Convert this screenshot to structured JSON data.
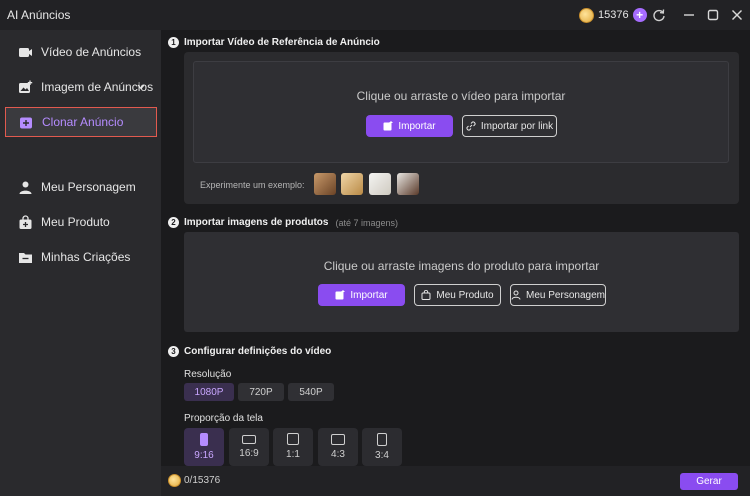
{
  "app": {
    "title": "AI Anúncios"
  },
  "header": {
    "credits": "15376",
    "plus": "+"
  },
  "sidebar": {
    "items": [
      {
        "label": "Vídeo de Anúncios"
      },
      {
        "label": "Imagem de Anúncios"
      },
      {
        "label": "Clonar Anúncio"
      },
      {
        "label": "Meu Personagem"
      },
      {
        "label": "Meu Produto"
      },
      {
        "label": "Minhas Criações"
      }
    ]
  },
  "section1": {
    "number": "1",
    "title": "Importar Vídeo de Referência de Anúncio",
    "drop_text": "Clique ou arraste o vídeo para importar",
    "import_label": "Importar",
    "link_label": "Importar por link",
    "examples_label": "Experimente um exemplo:"
  },
  "section2": {
    "number": "2",
    "title": "Importar imagens de produtos",
    "note": "(até 7 imagens)",
    "drop_text": "Clique ou arraste imagens do produto para importar",
    "import_label": "Importar",
    "product_label": "Meu Produto",
    "character_label": "Meu Personagem"
  },
  "section3": {
    "number": "3",
    "title": "Configurar definições do vídeo",
    "resolution_label": "Resolução",
    "resolutions": [
      "1080P",
      "720P",
      "540P"
    ],
    "selected_resolution": "1080P",
    "ratio_label": "Proporção da tela",
    "ratios": [
      "9:16",
      "16:9",
      "1:1",
      "4:3",
      "3:4"
    ],
    "selected_ratio": "9:16"
  },
  "footer": {
    "credits": "0/15376",
    "generate_label": "Gerar"
  },
  "colors": {
    "accent": "#8a4cf0",
    "active_border": "#e25a4f",
    "active_text": "#b58cff"
  }
}
